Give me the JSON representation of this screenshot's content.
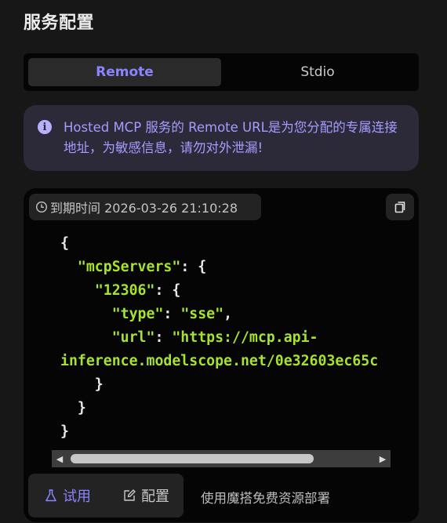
{
  "page": {
    "title": "服务配置"
  },
  "tabs": [
    {
      "label": "Remote",
      "active": true
    },
    {
      "label": "Stdio",
      "active": false
    }
  ],
  "notice": {
    "icon": "info-icon",
    "text": "Hosted MCP 服务的 Remote URL是为您分配的专属连接地址，为敏感信息，请勿对外泄漏!"
  },
  "config_card": {
    "expiry_icon": "clock-icon",
    "expiry_label": "到期时间 2026-03-26 21:10:28",
    "copy_icon": "copy-icon",
    "code": {
      "open_brace": "{",
      "servers_key": "\"mcpServers\"",
      "server_name": "\"12306\"",
      "type_key": "\"type\"",
      "type_value": "\"sse\"",
      "url_key": "\"url\"",
      "url_value_line1": "\"https://mcp.api-",
      "url_value_line2": "inference.modelscope.net/0e32603ec65c",
      "close_brace": "}"
    },
    "scroll_position": 0
  },
  "actions": {
    "try_label": "试用",
    "try_icon": "flask-icon",
    "config_label": "配置",
    "config_icon": "edit-icon",
    "free_deploy_label": "使用魔搭免费资源部署"
  },
  "colors": {
    "accent": "#8b83ff",
    "json_key": "#a6e22e",
    "notice_bg": "#2c2a38"
  }
}
